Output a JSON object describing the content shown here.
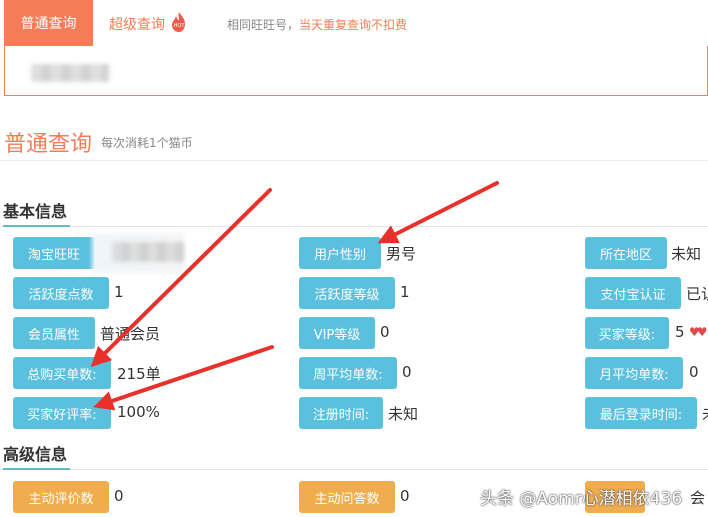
{
  "tabs": {
    "normal": "普通查询",
    "super": "超级查询",
    "hot_badge": "HOT",
    "hint_prefix": "相同旺旺号，",
    "hint_highlight": "当天重复查询不扣费"
  },
  "query": {
    "title": "普通查询",
    "subtitle": "每次消耗1个猫币"
  },
  "basic": {
    "title": "基本信息",
    "rows": [
      [
        {
          "label": "淘宝旺旺",
          "value": ""
        },
        {
          "label": "用户性别",
          "value": "男号"
        },
        {
          "label": "所在地区",
          "value": "未知"
        }
      ],
      [
        {
          "label": "活跃度点数",
          "value": "1"
        },
        {
          "label": "活跃度等级",
          "value": "1"
        },
        {
          "label": "支付宝认证",
          "value": "已认"
        }
      ],
      [
        {
          "label": "会员属性",
          "value": "普通会员"
        },
        {
          "label": "VIP等级",
          "value": "0"
        },
        {
          "label": "买家等级:",
          "value": "5"
        }
      ],
      [
        {
          "label": "总购买单数:",
          "value": "215单"
        },
        {
          "label": "周平均单数:",
          "value": "0"
        },
        {
          "label": "月平均单数:",
          "value": "0"
        }
      ],
      [
        {
          "label": "买家好评率:",
          "value": "100%"
        },
        {
          "label": "注册时间:",
          "value": "未知"
        },
        {
          "label": "最后登录时间:",
          "value": "未"
        }
      ]
    ]
  },
  "advanced": {
    "title": "高级信息",
    "rows": [
      [
        {
          "label": "主动评价数",
          "value": "0"
        },
        {
          "label": "主动问答数",
          "value": "0"
        },
        {
          "label": "",
          "value": "会"
        }
      ]
    ]
  },
  "watermark": "头条 @Aomr心潜相依436",
  "colors": {
    "accent": "#f47d58",
    "label_blue": "#5bc0de",
    "label_orange": "#f0ad4e",
    "section_underline": "#5dbfbf",
    "arrow": "#e8312a"
  }
}
